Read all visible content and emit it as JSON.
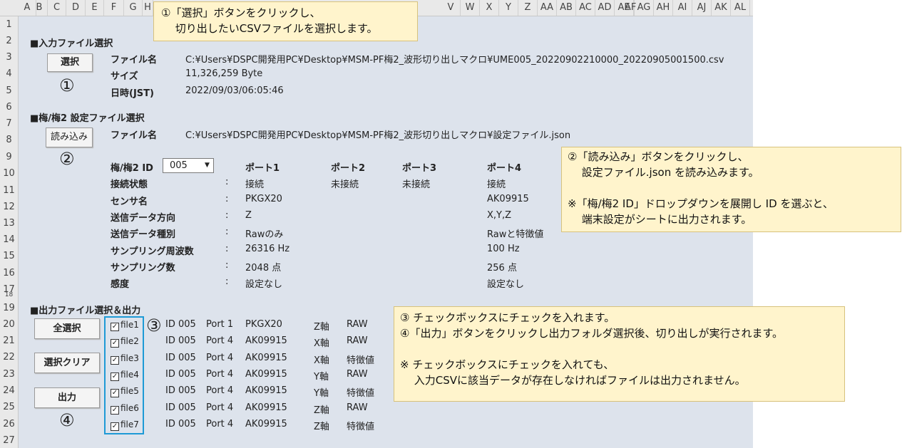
{
  "columns": [
    "A",
    "B",
    "C",
    "D",
    "E",
    "F",
    "G",
    "H",
    "",
    "",
    "",
    "",
    "",
    "",
    "",
    "",
    "",
    "",
    "",
    "",
    "",
    "V",
    "W",
    "X",
    "Y",
    "Z",
    "AA",
    "AB",
    "AC",
    "AD",
    "AE",
    "AF",
    "AG",
    "AH",
    "AI",
    "AJ",
    "AK",
    "AL"
  ],
  "rows": [
    "1",
    "2",
    "3",
    "4",
    "5",
    "6",
    "7",
    "8",
    "9",
    "10",
    "11",
    "12",
    "13",
    "14",
    "15",
    "16",
    "17",
    "18",
    "19",
    "20",
    "21",
    "22",
    "23",
    "24",
    "25",
    "26",
    "27"
  ],
  "input_section": {
    "heading": "■入力ファイル選択",
    "select_button": "選択",
    "marker": "①",
    "fields": [
      {
        "label": "ファイル名",
        "value": "C:¥Users¥DSPC開発用PC¥Desktop¥MSM-PF梅2_波形切り出しマクロ¥UME005_20220902210000_20220905001500.csv"
      },
      {
        "label": "サイズ",
        "value": "11,326,259 Byte"
      },
      {
        "label": "日時(JST)",
        "value": "2022/09/03/06:05:46"
      }
    ]
  },
  "settings_section": {
    "heading": "■梅/梅2 設定ファイル選択",
    "load_button": "読み込み",
    "marker": "②",
    "file_label": "ファイル名",
    "file_value": "C:¥Users¥DSPC開発用PC¥Desktop¥MSM-PF梅2_波形切り出しマクロ¥設定ファイル.json",
    "id_label": "梅/梅2 ID",
    "id_value": "005",
    "ports": [
      "ポート1",
      "ポート2",
      "ポート3",
      "ポート4"
    ],
    "rows": [
      {
        "label": "接続状態",
        "sep": ":",
        "p1": "接続",
        "p2": "未接続",
        "p3": "未接続",
        "p4": "接続"
      },
      {
        "label": "センサ名",
        "sep": ":",
        "p1": "PKGX20",
        "p2": "",
        "p3": "",
        "p4": "AK09915"
      },
      {
        "label": "送信データ方向",
        "sep": ":",
        "p1": "Z",
        "p2": "",
        "p3": "",
        "p4": "X,Y,Z"
      },
      {
        "label": "送信データ種別",
        "sep": ":",
        "p1": "Rawのみ",
        "p2": "",
        "p3": "",
        "p4": "Rawと特徴値"
      },
      {
        "label": "サンプリング周波数",
        "sep": ":",
        "p1": "26316 Hz",
        "p2": "",
        "p3": "",
        "p4": "100 Hz"
      },
      {
        "label": "サンプリング数",
        "sep": ":",
        "p1": "2048 点",
        "p2": "",
        "p3": "",
        "p4": "256 点"
      },
      {
        "label": "感度",
        "sep": ":",
        "p1": "設定なし",
        "p2": "",
        "p3": "",
        "p4": "設定なし"
      }
    ]
  },
  "output_section": {
    "heading": "■出力ファイル選択＆出力",
    "select_all_button": "全選択",
    "clear_button": "選択クリア",
    "output_button": "出力",
    "marker3": "③",
    "marker4": "④",
    "files": [
      {
        "check": "✓",
        "name": "file1",
        "id": "ID 005",
        "port": "Port 1",
        "sensor": "PKGX20",
        "axis": "Z軸",
        "type": "RAW"
      },
      {
        "check": "✓",
        "name": "file2",
        "id": "ID 005",
        "port": "Port 4",
        "sensor": "AK09915",
        "axis": "X軸",
        "type": "RAW"
      },
      {
        "check": "✓",
        "name": "file3",
        "id": "ID 005",
        "port": "Port 4",
        "sensor": "AK09915",
        "axis": "X軸",
        "type": "特徴値"
      },
      {
        "check": "✓",
        "name": "file4",
        "id": "ID 005",
        "port": "Port 4",
        "sensor": "AK09915",
        "axis": "Y軸",
        "type": "RAW"
      },
      {
        "check": "✓",
        "name": "file5",
        "id": "ID 005",
        "port": "Port 4",
        "sensor": "AK09915",
        "axis": "Y軸",
        "type": "特徴値"
      },
      {
        "check": "✓",
        "name": "file6",
        "id": "ID 005",
        "port": "Port 4",
        "sensor": "AK09915",
        "axis": "Z軸",
        "type": "RAW"
      },
      {
        "check": "✓",
        "name": "file7",
        "id": "ID 005",
        "port": "Port 4",
        "sensor": "AK09915",
        "axis": "Z軸",
        "type": "特徴値"
      }
    ]
  },
  "notes": {
    "note1": [
      "①「選択」ボタンをクリックし、",
      "　 切り出したいCSVファイルを選択します。"
    ],
    "note2": [
      "②「読み込み」ボタンをクリックし、",
      "　  設定ファイル.json を読み込みます。",
      "",
      "※「梅/梅2 ID」ドロップダウンを展開し ID を選ぶと、",
      "　  端末設定がシートに出力されます。"
    ],
    "note3": [
      "③ チェックボックスにチェックを入れます。",
      "④「出力」ボタンをクリックし出力フォルダ選択後、切り出しが実行されます。",
      "",
      "※ チェックボックスにチェックを入れても、",
      "　 入力CSVに該当データが存在しなければファイルは出力されません。"
    ]
  }
}
